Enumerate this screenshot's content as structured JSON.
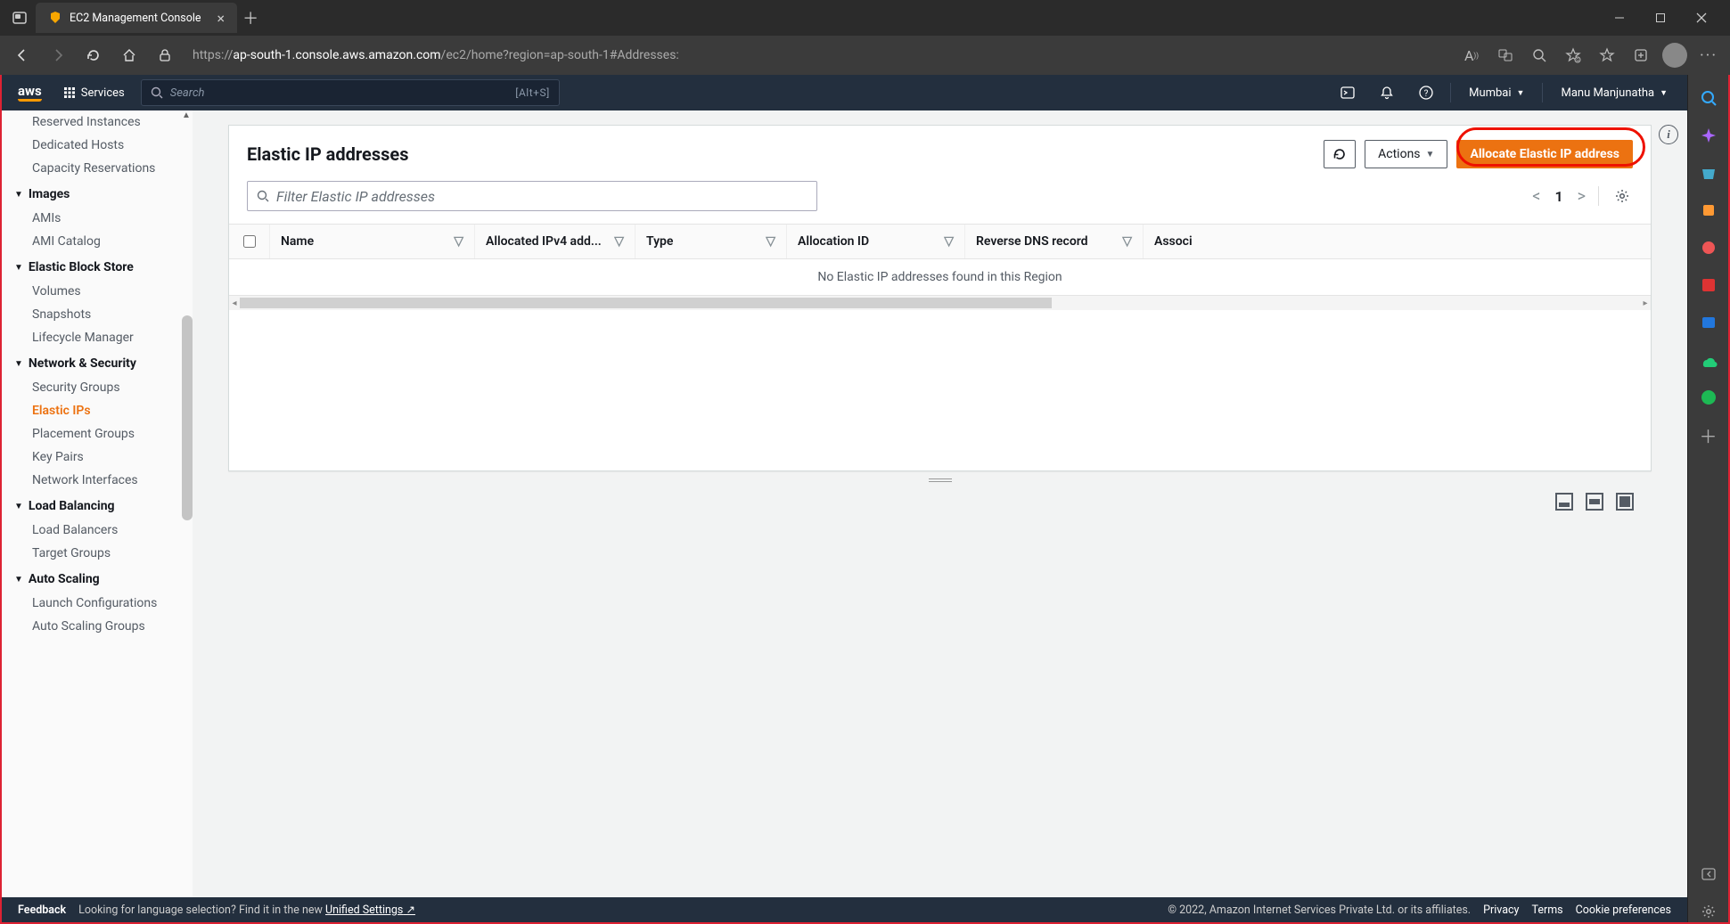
{
  "browser": {
    "tab_title": "EC2 Management Console",
    "url_prefix": "https://",
    "url_host": "ap-south-1.console.aws.amazon.com",
    "url_path": "/ec2/home?region=ap-south-1#Addresses:"
  },
  "aws_header": {
    "logo": "aws",
    "services": "Services",
    "search_placeholder": "Search",
    "search_shortcut": "[Alt+S]",
    "region": "Mumbai",
    "user": "Manu Manjunatha"
  },
  "sidebar": {
    "items_top": [
      "Reserved Instances",
      "Dedicated Hosts",
      "Capacity Reservations"
    ],
    "section_images": "Images",
    "images": [
      "AMIs",
      "AMI Catalog"
    ],
    "section_ebs": "Elastic Block Store",
    "ebs": [
      "Volumes",
      "Snapshots",
      "Lifecycle Manager"
    ],
    "section_net": "Network & Security",
    "net": [
      "Security Groups",
      "Elastic IPs",
      "Placement Groups",
      "Key Pairs",
      "Network Interfaces"
    ],
    "section_lb": "Load Balancing",
    "lb": [
      "Load Balancers",
      "Target Groups"
    ],
    "section_as": "Auto Scaling",
    "as": [
      "Launch Configurations",
      "Auto Scaling Groups"
    ],
    "active": "Elastic IPs"
  },
  "page": {
    "title": "Elastic IP addresses",
    "refresh": "Refresh",
    "actions": "Actions",
    "allocate": "Allocate Elastic IP address",
    "filter_placeholder": "Filter Elastic IP addresses",
    "page_number": "1",
    "columns": {
      "name": "Name",
      "allocated": "Allocated IPv4 add...",
      "type": "Type",
      "allocation_id": "Allocation ID",
      "reverse_dns": "Reverse DNS record",
      "associ": "Associ"
    },
    "empty": "No Elastic IP addresses found in this Region"
  },
  "footer": {
    "feedback": "Feedback",
    "lang_prompt": "Looking for language selection? Find it in the new ",
    "unified": "Unified Settings",
    "copyright": "© 2022, Amazon Internet Services Private Ltd. or its affiliates.",
    "privacy": "Privacy",
    "terms": "Terms",
    "cookies": "Cookie preferences"
  }
}
